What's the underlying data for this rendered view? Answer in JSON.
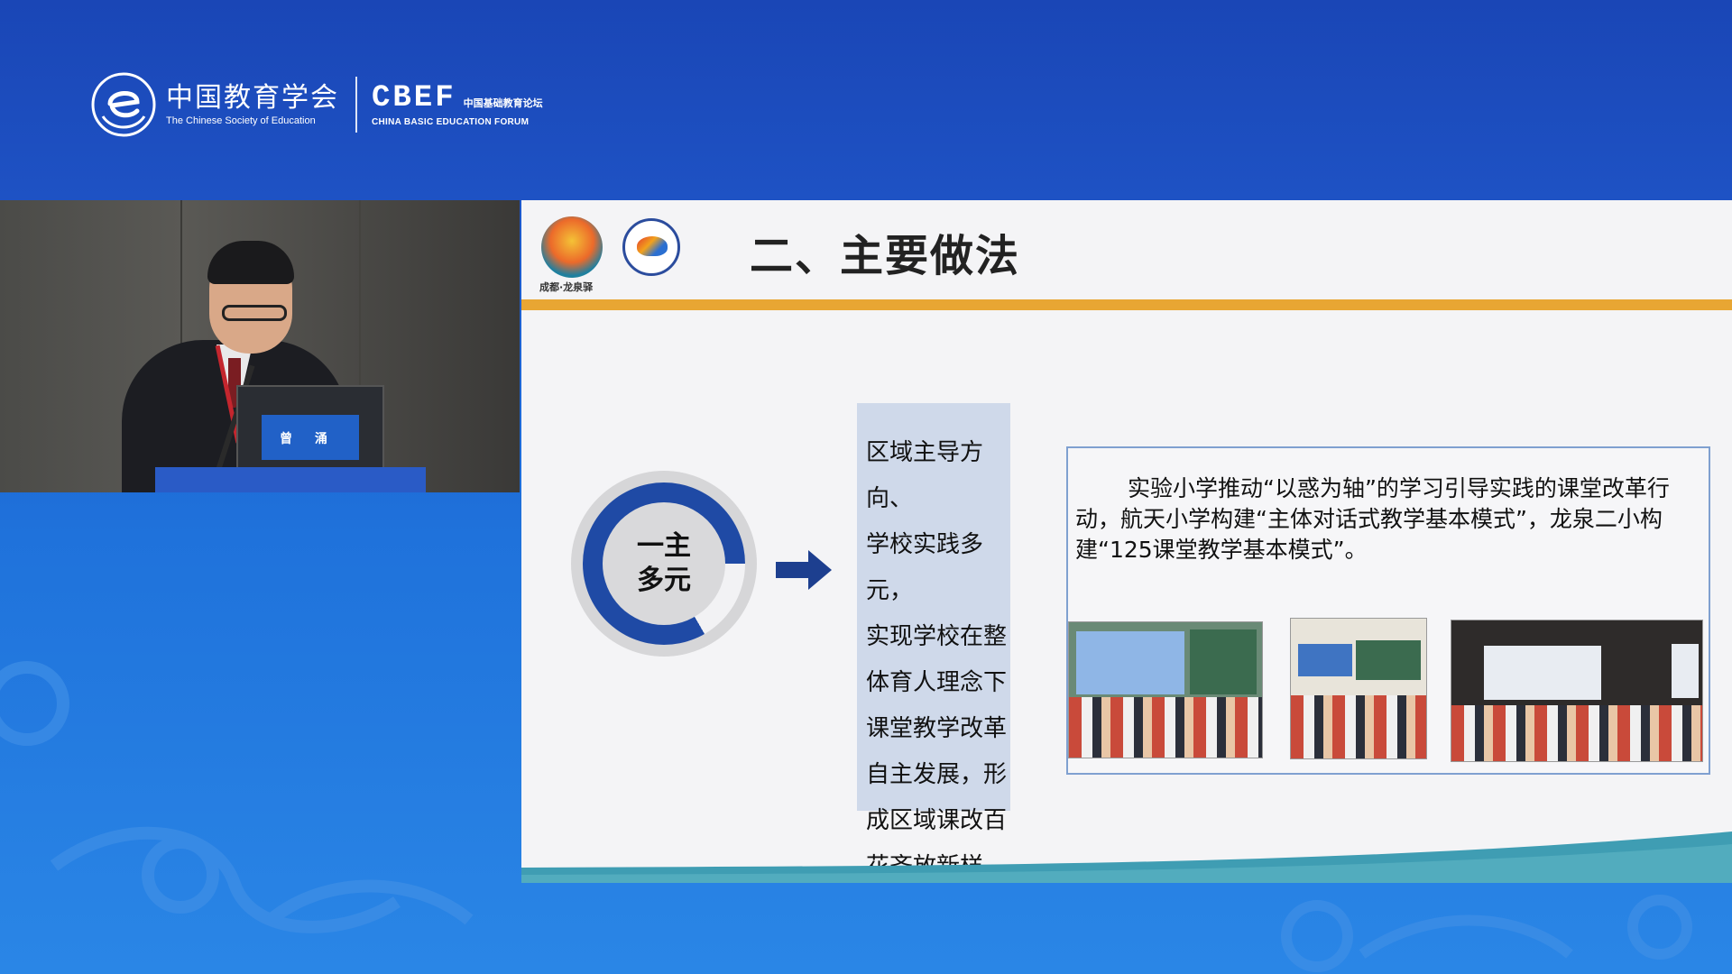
{
  "header": {
    "org_cn": "中国教育学会",
    "org_en": "The Chinese Society of Education",
    "forum_abbr": "CBEF",
    "forum_cn": "中国基础教育论坛",
    "forum_en": "CHINA BASIC EDUCATION FORUM"
  },
  "video": {
    "nameplate": "曾  涌"
  },
  "slide": {
    "logo1_caption": "成都·龙泉驿",
    "title": "二、主要做法",
    "circle_line1": "一主",
    "circle_line2": "多元",
    "vertical_lines": [
      "区域主导方向、",
      "学校实践多元，",
      "实现学校在整",
      "体育人理念下",
      "课堂教学改革",
      "自主发展，形",
      "成区域课改百",
      "花齐放新样态。"
    ],
    "quote": "实验小学推动“以惑为轴”的学习引导实践的课堂改革行动，航天小学构建“主体对话式教学基本模式”，龙泉二小构建“125课堂教学基本模式”。"
  },
  "colors": {
    "header_blue": "#1a46b6",
    "gold_bar": "#e8a633",
    "ring_blue": "#1f4aa5",
    "arrow_navy": "#1d3f8f",
    "box_bg": "#cfd9ea",
    "wave_teal": "#3f9db3"
  }
}
